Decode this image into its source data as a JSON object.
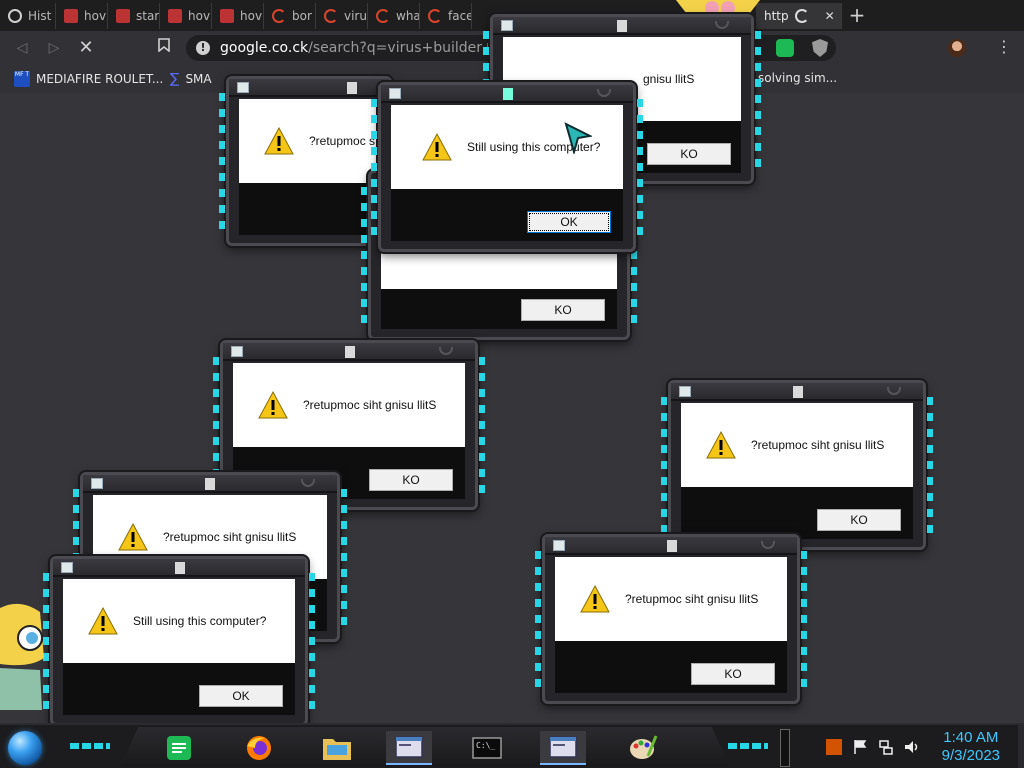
{
  "browser": {
    "tabs": [
      {
        "label": "Hist",
        "icon": "history-icon"
      },
      {
        "label": "hov",
        "icon": "youtube-icon"
      },
      {
        "label": "star",
        "icon": "youtube-icon"
      },
      {
        "label": "hov",
        "icon": "youtube-icon"
      },
      {
        "label": "hov",
        "icon": "youtube-icon"
      },
      {
        "label": "bor",
        "icon": "loading-icon"
      },
      {
        "label": "viru",
        "icon": "loading-icon"
      },
      {
        "label": "wha",
        "icon": "loading-icon"
      },
      {
        "label": "face",
        "icon": "loading-icon"
      },
      {
        "label": "http",
        "icon": "loading-icon"
      }
    ],
    "close_tab": "✕",
    "new_tab": "+",
    "url_host": "google.co.ck",
    "url_path": "/search?q=virus+builder+leg",
    "bookmarks": [
      {
        "label": "MEDIAFIRE ROULET...",
        "icon_text": "MF T"
      },
      {
        "label": "SMA"
      },
      {
        "label": "solving sim..."
      }
    ]
  },
  "dialogs": [
    {
      "message": "Still using this computer?",
      "ok_label": "KO",
      "visible_text": "gnisu llitS"
    },
    {
      "message": "?retupmoc s",
      "ok_label": "KO"
    },
    {
      "message": "Still using this computer?",
      "ok_label": "OK"
    },
    {
      "message": "",
      "ok_label": "KO"
    },
    {
      "message": "?retupmoc siht gnisu llitS",
      "ok_label": "KO"
    },
    {
      "message": "?retupmoc siht gnisu llitS",
      "ok_label": "KO"
    },
    {
      "message": "?retupmoc siht gnisu llitS",
      "ok_label": "KO"
    },
    {
      "message": "?retupmoc siht gnisu llitS",
      "ok_label": "KO"
    },
    {
      "message": "Still using this computer?",
      "ok_label": "OK"
    }
  ],
  "taskbar": {
    "time": "1:40 AM",
    "date": "9/3/2023",
    "apps": [
      "notes-icon",
      "firefox-icon",
      "file-manager-icon",
      "window-icon",
      "terminal-icon",
      "window-icon",
      "paint-icon"
    ]
  },
  "colors": {
    "accent_cyan": "#27d7e6",
    "clock": "#3fc7ff",
    "warning_yellow": "#f5c518"
  }
}
